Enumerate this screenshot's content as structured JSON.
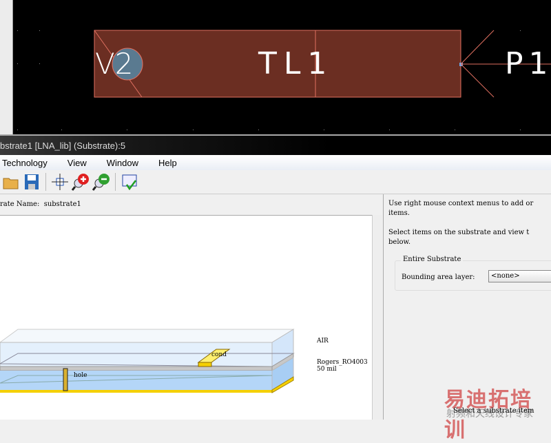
{
  "layout_view": {
    "labels": {
      "v2": "V2",
      "tl1": "TL1",
      "p1": "P1"
    }
  },
  "window": {
    "title": "bstrate1 [LNA_lib] (Substrate):5"
  },
  "menu": [
    "Technology",
    "View",
    "Window",
    "Help"
  ],
  "toolbar": {
    "icons": [
      "open-folder-icon",
      "save-icon",
      "pan-icon",
      "zoom-in-icon",
      "zoom-out-icon",
      "check-icon"
    ]
  },
  "substrate": {
    "name_label": "rate Name:",
    "name_value": "substrate1"
  },
  "drawing": {
    "air": "AIR",
    "dielectric": "Rogers_RO4003",
    "thickness": "50 mil",
    "cond": "cond",
    "hole": "hole"
  },
  "right_panel": {
    "line1a": "Use right mouse context menus to add or",
    "line1b": "items.",
    "line2a": "Select items on the substrate and view t",
    "line2b": "below.",
    "group_title": "Entire Substrate",
    "bounding_label": "Bounding area layer:",
    "bounding_value": "<none>",
    "select_hint": "Select a substrate item"
  },
  "watermark": {
    "main": "易迪拓培训",
    "sub": "射频和天线设计专家"
  }
}
